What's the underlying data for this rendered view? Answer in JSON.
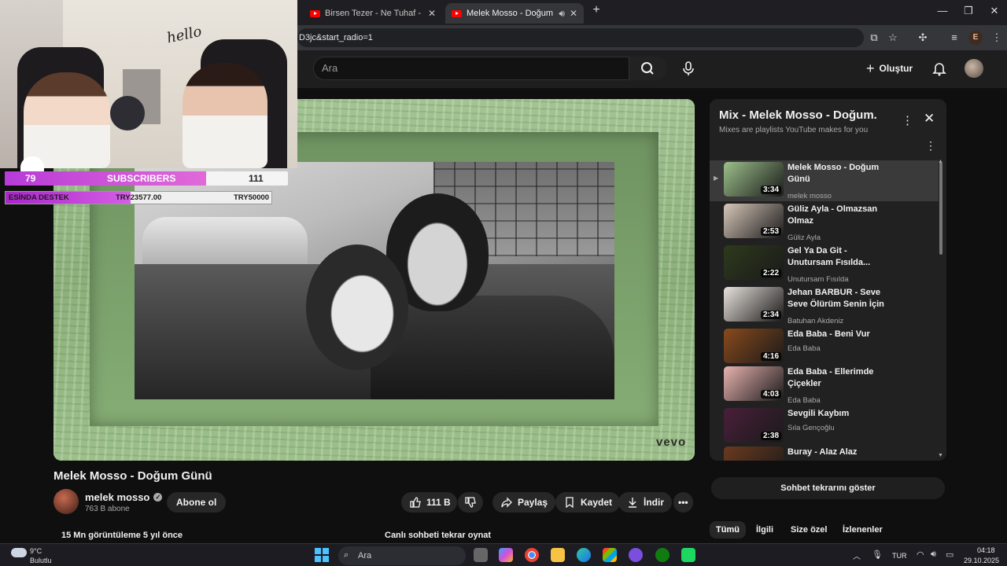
{
  "browser": {
    "tabs": [
      {
        "title": "Birsen Tezer - Ne Tuhaf - YouTube",
        "active": false
      },
      {
        "title": "Melek Mosso - Doğum Günü",
        "active": true
      }
    ],
    "url": "D3jc&start_radio=1",
    "profile_initial": "E"
  },
  "header": {
    "search_placeholder": "Ara",
    "create_label": "Oluştur"
  },
  "player": {
    "watermark": "vevo"
  },
  "stream_overlay": {
    "hello_text": "hello",
    "sub_goal": {
      "current": "79",
      "label": "SUBSCRIBERS",
      "target": "111",
      "progress": 0.71
    },
    "donation": {
      "label": "ESİNDA DESTEK",
      "current": "TRY23577.00",
      "target": "TRY50000",
      "progress": 0.47
    }
  },
  "video": {
    "title": "Melek Mosso - Doğum Günü",
    "channel": "melek mosso",
    "subscribers": "763 B abone",
    "subscribe_label": "Abone ol",
    "likes": "111 B",
    "share_label": "Paylaş",
    "save_label": "Kaydet",
    "download_label": "İndir",
    "views": "15 Mn görüntüleme  5 yıl önce",
    "replay_label": "Canlı sohbeti tekrar oynat"
  },
  "mix": {
    "title": "Mix - Melek Mosso - Doğum...",
    "subtitle": "Mixes are playlists YouTube makes for you",
    "items": [
      {
        "title": "Melek Mosso - Doğum Günü",
        "artist": "melek mosso",
        "duration": "3:34",
        "thumb": "#9cc08b"
      },
      {
        "title": "Güliz Ayla - Olmazsan Olmaz",
        "artist": "Güliz Ayla",
        "duration": "2:53",
        "thumb": "#d7c7b9"
      },
      {
        "title": "Gel Ya Da Git - Unutursam Fısılda...",
        "artist": "Unutursam Fısılda",
        "duration": "2:22",
        "thumb": "#2d3a1c"
      },
      {
        "title": "Jehan BARBUR - Seve Seve Ölürüm Senin İçin",
        "artist": "Batuhan Akdeniz",
        "duration": "2:34",
        "thumb": "#e8e2dc"
      },
      {
        "title": "Eda Baba - Beni Vur",
        "artist": "Eda Baba",
        "duration": "4:16",
        "thumb": "#8a4a1c"
      },
      {
        "title": "Eda Baba - Ellerimde Çiçekler",
        "artist": "Eda Baba",
        "duration": "4:03",
        "thumb": "#e8b3b0"
      },
      {
        "title": "Sevgili Kaybım",
        "artist": "Sıla Gençoğlu",
        "duration": "2:38",
        "thumb": "#4a1f3a"
      },
      {
        "title": "Buray - Alaz Alaz",
        "artist": "",
        "duration": "",
        "thumb": "#6b3a1e"
      }
    ]
  },
  "chat_replay_label": "Sohbet tekrarını göster",
  "chips": [
    "Tümü",
    "İlgili",
    "Size özel",
    "İzlenenler"
  ],
  "taskbar": {
    "temp": "9°C",
    "condition": "Bulutlu",
    "search_placeholder": "Ara",
    "language": "TUR",
    "time": "04:18",
    "date": "29.10.2025"
  }
}
